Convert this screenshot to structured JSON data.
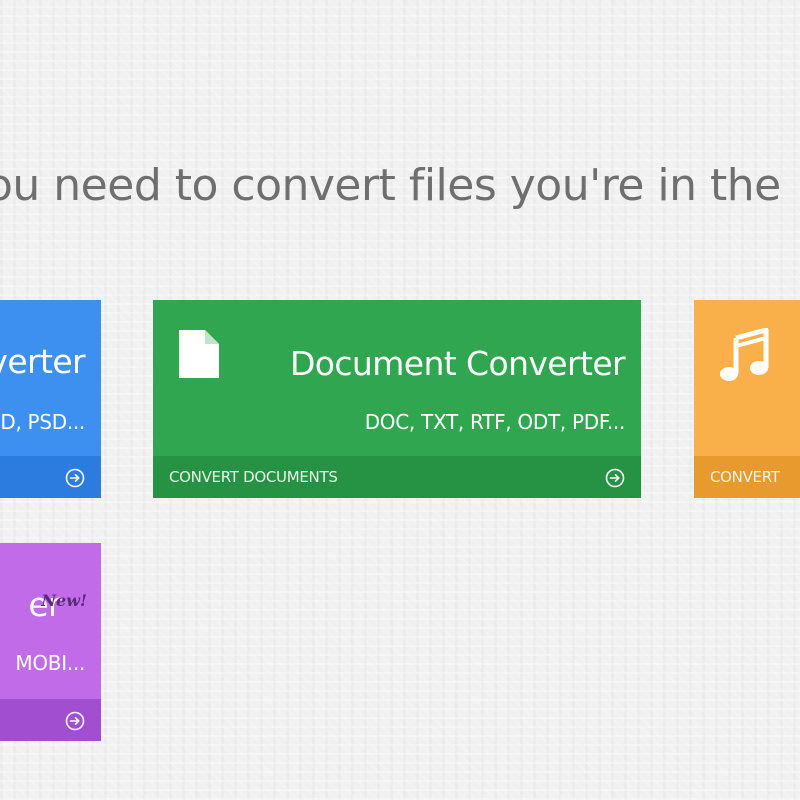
{
  "headline": "ou need to convert files you're in the",
  "tiles": {
    "image": {
      "title": "verter",
      "formats": "D, PSD...",
      "cta": "",
      "icon": "arrow-circle-right-icon",
      "color": "#3d8ff0"
    },
    "document": {
      "title": "Document Converter",
      "formats": "DOC, TXT, RTF, ODT, PDF...",
      "cta": "CONVERT DOCUMENTS",
      "icon": "document-icon",
      "color": "#31a650"
    },
    "audio": {
      "title": "",
      "formats": "",
      "cta": "CONVERT",
      "icon": "music-note-icon",
      "color": "#f9b04a"
    },
    "ebook": {
      "title": "er",
      "badge": "New!",
      "formats": "MOBI...",
      "cta": "",
      "icon": "arrow-circle-right-icon",
      "color": "#c26be9"
    }
  }
}
